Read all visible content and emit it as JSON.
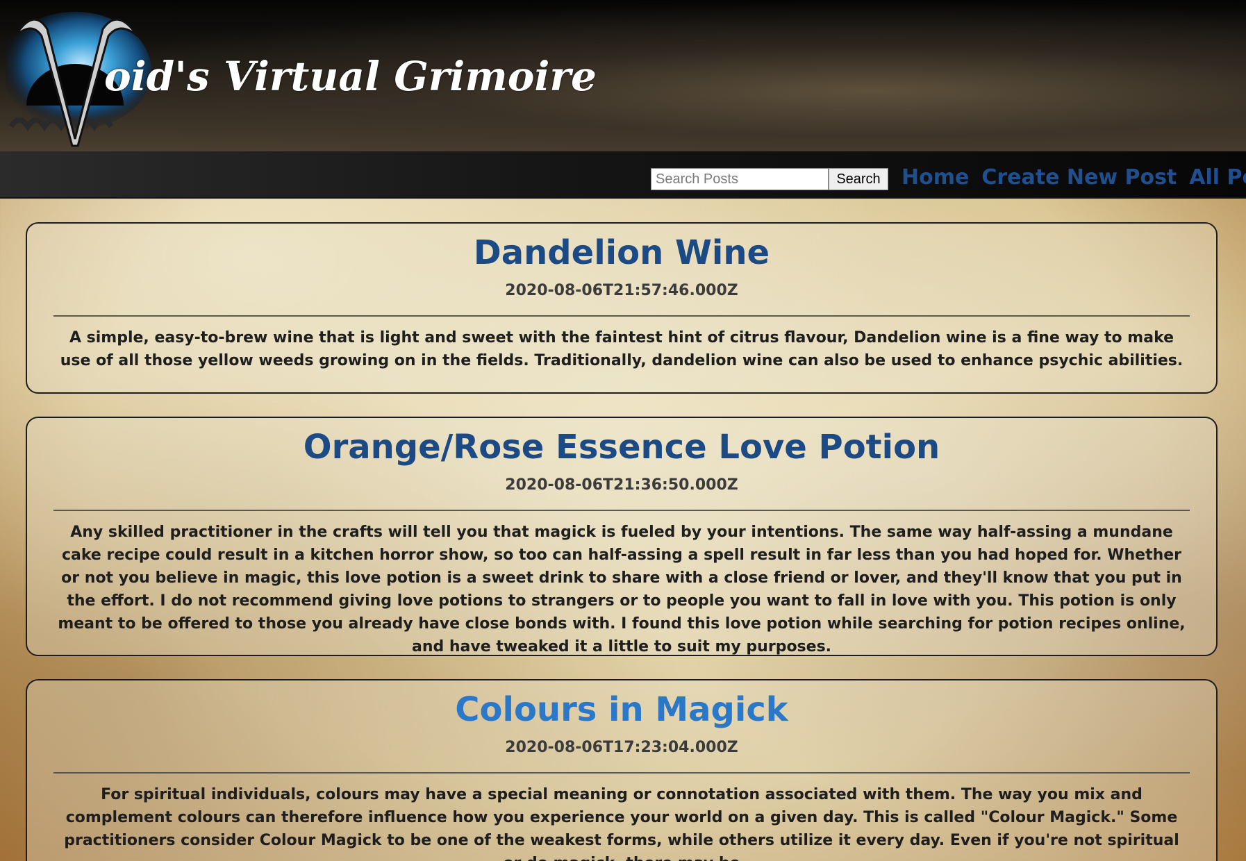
{
  "header": {
    "site_title": "oid's Virtual Grimoire",
    "logo_letter": "V"
  },
  "nav": {
    "search_placeholder": "Search Posts",
    "search_value": "",
    "search_button": "Search",
    "links": [
      {
        "label": "Home"
      },
      {
        "label": "Create New Post"
      },
      {
        "label": "All Posts"
      }
    ]
  },
  "posts": [
    {
      "title": "Dandelion Wine",
      "date": "2020-08-06T21:57:46.000Z",
      "excerpt": "A simple, easy-to-brew wine that is light and sweet with the faintest hint of citrus flavour, Dandelion wine is a fine way to make use of all those yellow weeds growing on in the fields. Traditionally, dandelion wine can also be used to enhance psychic abilities."
    },
    {
      "title": "Orange/Rose Essence Love Potion",
      "date": "2020-08-06T21:36:50.000Z",
      "excerpt": "Any skilled practitioner in the crafts will tell you that magick is fueled by your intentions. The same way half-assing a mundane cake recipe could result in a kitchen horror show, so too can half-assing a spell result in far less than you had hoped for. Whether or not you believe in magic, this love potion is a sweet drink to share with a close friend or lover, and they'll know that you put in the effort. I do not recommend giving love potions to strangers or to people you want to fall in love with you. This potion is only meant to be offered to those you already have close bonds with. I found this love potion while searching for potion recipes online, and have tweaked it a little to suit my purposes."
    },
    {
      "title": "Colours in Magick",
      "date": "2020-08-06T17:23:04.000Z",
      "excerpt": "For spiritual individuals, colours may have a special meaning or connotation associated with them. The way you mix and complement colours can therefore influence how you experience your world on a given day. This is called \"Colour Magick.\" Some practitioners consider Colour Magick to be one of the weakest forms, while others utilize it every day. Even if you're not spiritual or do magick, there may be"
    }
  ]
}
